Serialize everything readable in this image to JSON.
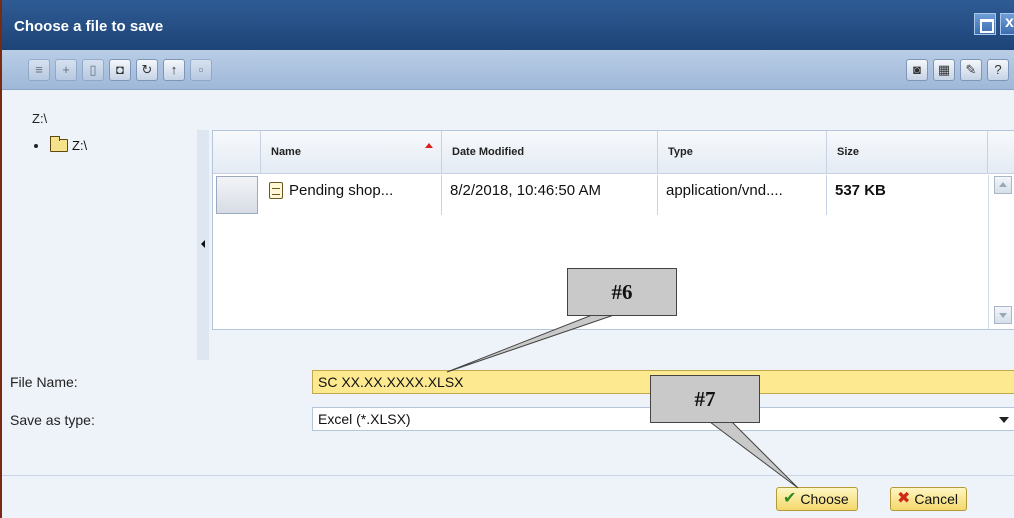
{
  "window": {
    "title": "Choose a file to save"
  },
  "toolbar": {
    "left_icons": [
      "view-list-icon",
      "new-folder-icon",
      "delete-icon",
      "rename-icon",
      "refresh-icon",
      "up-folder-icon",
      "properties-icon"
    ],
    "right_icons": [
      "view-mode-icon",
      "details-icon",
      "edit-icon",
      "help-icon"
    ]
  },
  "path": {
    "current": "Z:\\"
  },
  "tree": {
    "items": [
      {
        "label": "Z:\\"
      }
    ]
  },
  "file_list": {
    "columns": [
      "Name",
      "Date Modified",
      "Type",
      "Size"
    ],
    "sort_column": "Name",
    "rows": [
      {
        "name": "Pending shop...",
        "date_modified": "8/2/2018, 10:46:50 AM",
        "type": "application/vnd....",
        "size": "537 KB"
      }
    ]
  },
  "form": {
    "file_name_label": "File Name:",
    "file_name_value": "SC XX.XX.XXXX.XLSX",
    "save_as_type_label": "Save as type:",
    "save_as_type_value": "Excel (*.XLSX)"
  },
  "buttons": {
    "choose": "Choose",
    "cancel": "Cancel"
  },
  "callouts": {
    "c6": "#6",
    "c7": "#7"
  },
  "colors": {
    "title_bar": "#1d4477",
    "file_name_highlight": "#fde98f",
    "button_yellow": "#f4d86b",
    "callout_gray": "#c9c9c9"
  }
}
